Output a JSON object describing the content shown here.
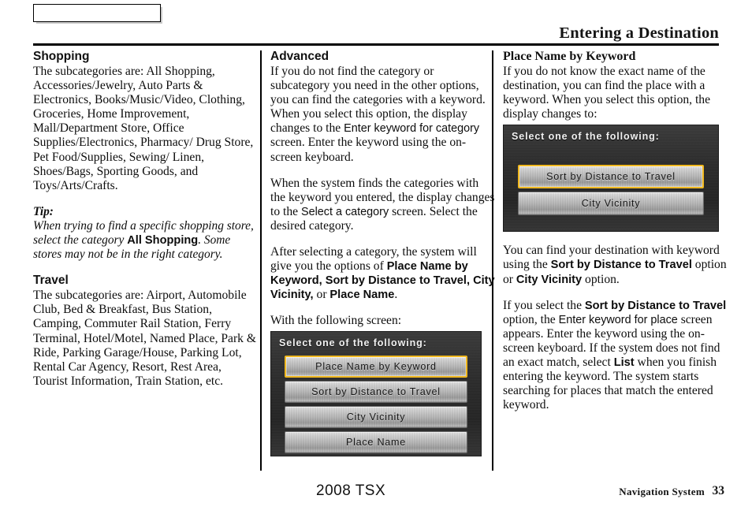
{
  "header": {
    "title": "Entering a Destination",
    "tab_label": ""
  },
  "footer": {
    "model": "2008  TSX",
    "system": "Navigation System",
    "page_number": "33"
  },
  "colors": {
    "highlight": "#f0b820",
    "screen_background": "#2b2b2b",
    "button_face": "#b5b5b5",
    "rule": "#000000"
  },
  "column_left": {
    "shopping": {
      "heading": "Shopping",
      "body": "The subcategories are: All Shopping, Accessories/Jewelry, Auto Parts & Electronics, Books/Music/Video, Clothing, Groceries, Home Improvement, Mall/Department Store, Office Supplies/Electronics, Pharmacy/ Drug Store, Pet Food/Supplies, Sewing/ Linen, Shoes/Bags, Sporting Goods, and Toys/Arts/Crafts."
    },
    "tip": {
      "label": "Tip:",
      "part_1": "When trying to find a specific shopping store, select the category ",
      "emphasis_1": "All Shopping",
      "part_2": ". Some stores may not be in the right category."
    },
    "travel": {
      "heading": "Travel",
      "body": "The subcategories are: Airport, Automobile Club, Bed & Breakfast, Bus Station, Camping, Commuter Rail Station, Ferry Terminal, Hotel/Motel, Named Place, Park & Ride, Parking Garage/House, Parking Lot, Rental Car Agency, Resort, Rest Area, Tourist Information, Train Station, etc."
    }
  },
  "column_middle": {
    "advanced": {
      "heading": "Advanced",
      "para_1_a": "If you do not find the category or subcategory you need in the other options, you can find the categories with a keyword. When you select this option, the display changes to the ",
      "para_1_screen": "Enter keyword for category",
      "para_1_b": " screen. Enter the keyword using the on-screen keyboard.",
      "para_2_a": "When the system finds the categories with the keyword you entered, the display changes to the ",
      "para_2_screen": "Select a category",
      "para_2_b": " screen. Select the desired category.",
      "para_3_a": "After selecting a category, the system will give you the options of ",
      "para_3_opt_1": "Place Name by Keyword, Sort by Distance to Travel, City Vicinity,",
      "para_3_mid": " or ",
      "para_3_opt_2": "Place Name",
      "para_3_b": ".",
      "para_4": "With the following screen:"
    },
    "screen": {
      "title": "Select one of the following:",
      "buttons": [
        {
          "label": "Place Name by Keyword",
          "selected": true
        },
        {
          "label": "Sort by Distance to Travel",
          "selected": false
        },
        {
          "label": "City Vicinity",
          "selected": false
        },
        {
          "label": "Place Name",
          "selected": false
        }
      ]
    }
  },
  "column_right": {
    "place_name_by_keyword": {
      "heading": "Place Name by Keyword",
      "para_1": "If you do not know the exact name of the destination, you can find the place with a keyword. When you select this option, the display changes to:"
    },
    "screen": {
      "title": "Select one of the following:",
      "buttons": [
        {
          "label": "Sort by Distance to Travel",
          "selected": true
        },
        {
          "label": "City Vicinity",
          "selected": false
        }
      ]
    },
    "para_2_a": "You can find your destination with keyword using the ",
    "para_2_opt_1": "Sort by Distance to Travel",
    "para_2_mid": " option or ",
    "para_2_opt_2": "City Vicinity",
    "para_2_b": " option.",
    "para_3_a": "If you select the ",
    "para_3_opt": "Sort by Distance to Travel",
    "para_3_b": " option, the ",
    "para_3_screen": "Enter keyword for place",
    "para_3_c": " screen appears. Enter the keyword using the on-screen keyboard. If the system does not find an exact match, select ",
    "para_3_opt_2": "List",
    "para_3_d": " when you finish entering the keyword. The system starts searching for places that match the entered keyword."
  }
}
